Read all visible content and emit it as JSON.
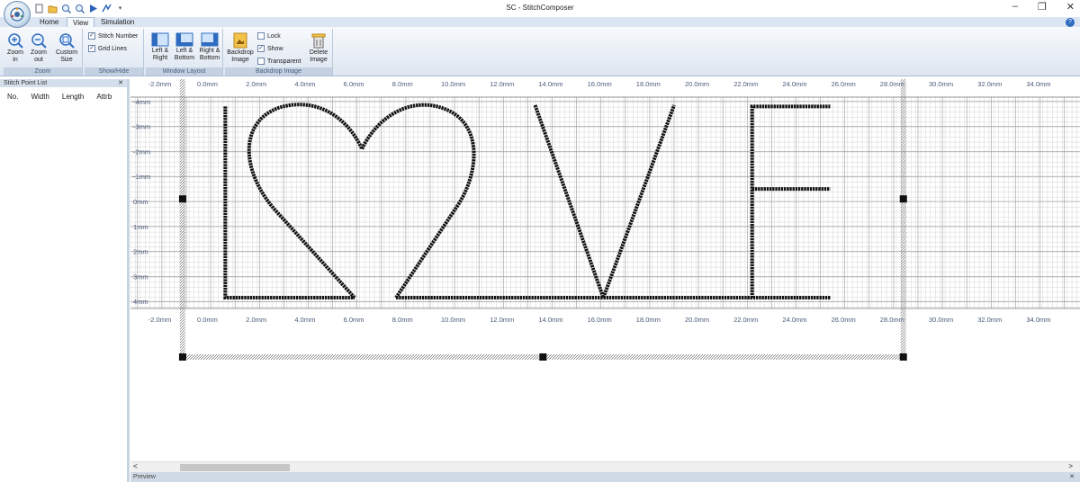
{
  "window": {
    "title": "SC - StitchComposer",
    "minimize_glyph": "–",
    "restore_glyph": "❐",
    "close_glyph": "✕"
  },
  "quick_access": [
    "new-icon",
    "open-icon",
    "zoom-in-icon",
    "zoom-out-icon",
    "play-icon",
    "stitch-icon",
    "dropdown-icon"
  ],
  "tabs": [
    {
      "label": "Home",
      "active": false
    },
    {
      "label": "View",
      "active": true
    },
    {
      "label": "Simulation",
      "active": false
    }
  ],
  "help_glyph": "?",
  "ribbon": {
    "zoom": {
      "label": "Zoom",
      "zoom_in": "Zoom in",
      "zoom_out": "Zoom out",
      "custom_size": "Custom Size"
    },
    "show_hide": {
      "label": "Show/Hide",
      "stitch_number": "Stitch Number",
      "stitch_number_checked": true,
      "grid_lines": "Grid Lines",
      "grid_lines_checked": true
    },
    "window_layout": {
      "label": "Window Layout",
      "left_right": "Left & Right",
      "left_bottom": "Left & Bottom",
      "right_bottom": "Right & Bottom"
    },
    "backdrop": {
      "label": "Backdrop Image",
      "backdrop_image": "Backdrop Image",
      "lock": "Lock",
      "lock_checked": false,
      "show": "Show",
      "show_checked": true,
      "transparent": "Transparent",
      "transparent_checked": false,
      "delete_image": "Delete Image"
    }
  },
  "stitch_panel": {
    "title": "Stitch Point List",
    "close": "✕",
    "columns": [
      "No.",
      "Width",
      "Length",
      "Attrb"
    ]
  },
  "ruler": {
    "x_labels": [
      "-2.0mm",
      "0.0mm",
      "2.0mm",
      "4.0mm",
      "6.0mm",
      "8.0mm",
      "10.0mm",
      "12.0mm",
      "14.0mm",
      "16.0mm",
      "18.0mm",
      "20.0mm",
      "22.0mm",
      "24.0mm",
      "26.0mm",
      "28.0mm",
      "30.0mm",
      "32.0mm",
      "34.0mm"
    ],
    "y_labels": [
      "-4mm",
      "-3mm",
      "-2mm",
      "-1mm",
      "0mm",
      "1mm",
      "2mm",
      "3mm",
      "4mm"
    ]
  },
  "design_text": "LOVE",
  "scroll_left_glyph": "<",
  "scroll_right_glyph": ">",
  "preview": {
    "title": "Preview",
    "close": "✕"
  }
}
